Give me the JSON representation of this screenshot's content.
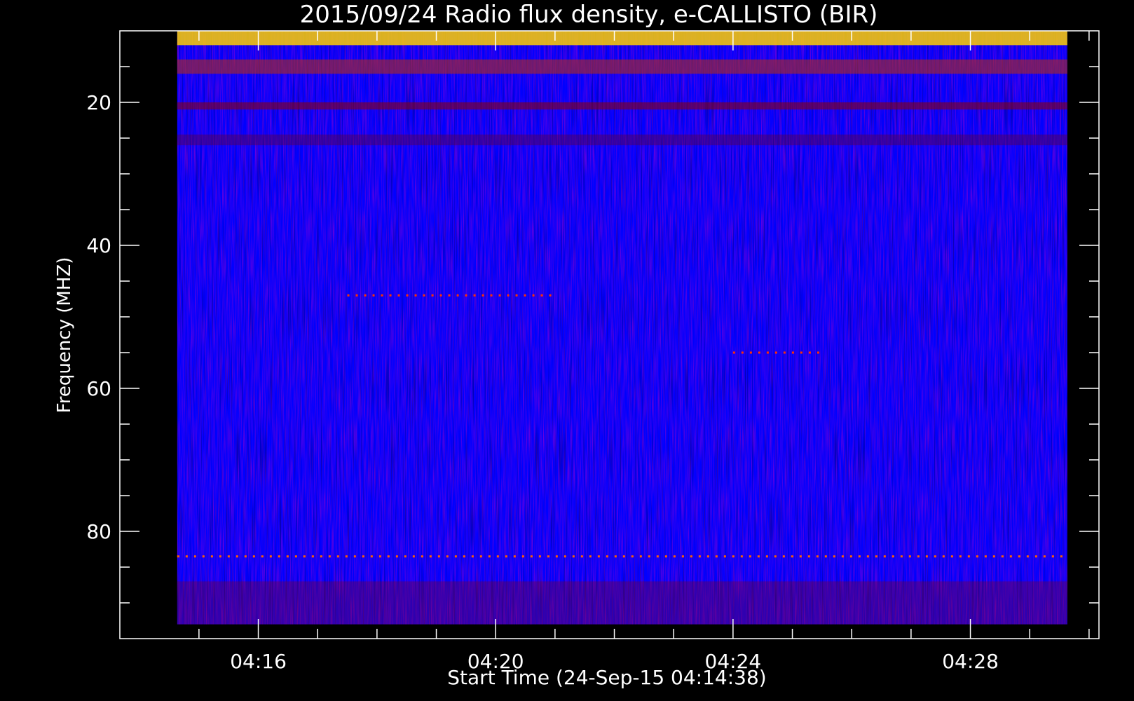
{
  "chart_data": {
    "type": "heatmap",
    "title": "2015/09/24  Radio flux density, e-CALLISTO (BIR)",
    "xlabel": "Start Time (24-Sep-15 04:14:38)",
    "ylabel": "Frequency (MHZ)",
    "x_range_minutes": [
      "04:13:40",
      "04:30:10"
    ],
    "data_time_range": [
      "04:14:38",
      "04:29:38"
    ],
    "ylim": [
      95,
      10
    ],
    "y_inverted": true,
    "data_freq_range_mhz": [
      10,
      93
    ],
    "x_ticks": [
      "04:16",
      "04:20",
      "04:24",
      "04:28"
    ],
    "y_ticks": [
      20,
      40,
      60,
      80
    ],
    "colormap": [
      "#000000",
      "#0000ff",
      "#a00000",
      "#ff5000",
      "#ffff80"
    ],
    "background_color": "#0000ff",
    "features": [
      {
        "kind": "band",
        "freq_mhz": [
          10,
          12
        ],
        "intensity": "high",
        "color": "#ffd000"
      },
      {
        "kind": "band",
        "freq_mhz": [
          14,
          16
        ],
        "intensity": "medium",
        "color": "#c03000"
      },
      {
        "kind": "band",
        "freq_mhz": [
          20,
          21
        ],
        "intensity": "medium",
        "color": "#900000"
      },
      {
        "kind": "band",
        "freq_mhz": [
          24.5,
          26
        ],
        "intensity": "low",
        "color": "#700010"
      },
      {
        "kind": "line",
        "freq_mhz": 47,
        "time_range": [
          "04:17:30",
          "04:21:00"
        ],
        "color": "#ff3000"
      },
      {
        "kind": "line",
        "freq_mhz": 55,
        "time_range": [
          "04:24:00",
          "04:25:30"
        ],
        "color": "#ff3000"
      },
      {
        "kind": "line",
        "freq_mhz": 83.5,
        "time_range": [
          "04:14:38",
          "04:29:38"
        ],
        "color": "#ff6000"
      },
      {
        "kind": "band",
        "freq_mhz": [
          87,
          93
        ],
        "intensity": "low",
        "color": "#800020"
      }
    ]
  }
}
